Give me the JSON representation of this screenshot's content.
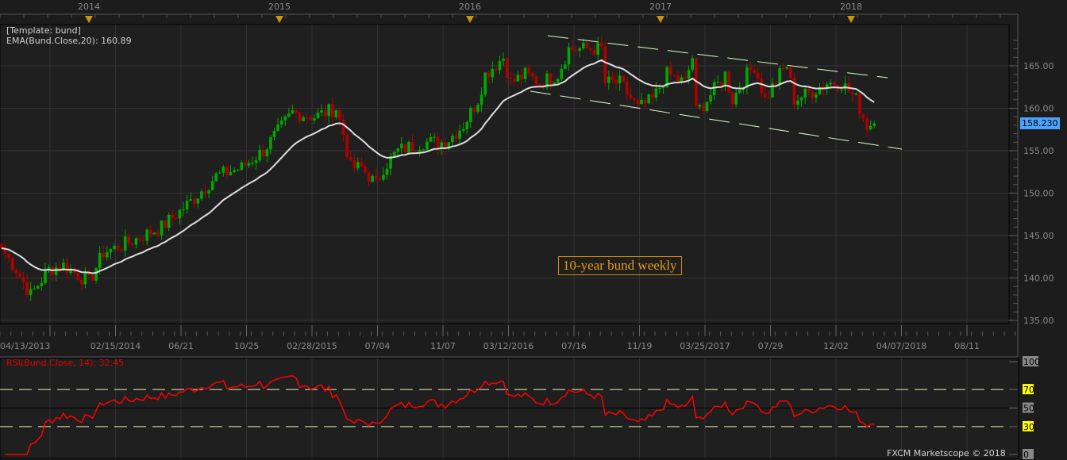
{
  "legend": {
    "template": "[Template: bund]",
    "ema": "EMA(Bund.Close,20): 160.89"
  },
  "rsi_label": "RSI(Bund.Close, 14): 32.45",
  "current_price": "158.230",
  "annotation": "10-year bund weekly",
  "footer": "FXCM Marketscope © 2018",
  "colors": {
    "bull": "#00a800",
    "bear": "#b00000",
    "ema": "#dddddd",
    "rsi": "#ff0000",
    "channel": "#d8ffc8",
    "badge": "#4aa3ff"
  },
  "chart_data": {
    "type": "candlestick",
    "title": "10-year bund weekly",
    "years": [
      "2014",
      "2015",
      "2016",
      "2017",
      "2018"
    ],
    "date_labels": [
      "04/13/2013",
      "02/15/2014",
      "06/21",
      "10/25",
      "02/28/2015",
      "07/04",
      "11/07",
      "03/12/2016",
      "07/16",
      "11/19",
      "03/25/2017",
      "07/29",
      "12/02",
      "04/07/2018",
      "08/11"
    ],
    "price_ticks": [
      "165.00",
      "160.00",
      "155.00",
      "150.00",
      "145.00",
      "140.00",
      "135.00"
    ],
    "price_tick_values": [
      165,
      160,
      155,
      150,
      145,
      140,
      135
    ],
    "ylim": [
      134,
      169
    ],
    "rsi_ticks": [
      "100",
      "70",
      "50",
      "30",
      "0"
    ],
    "rsi_tick_values": [
      100,
      70,
      50,
      30,
      0
    ],
    "weekly_close_keyframes": [
      [
        0,
        143.5
      ],
      [
        4,
        141
      ],
      [
        8,
        138
      ],
      [
        13,
        141
      ],
      [
        17,
        141.5
      ],
      [
        24,
        139.5
      ],
      [
        28,
        143
      ],
      [
        34,
        144
      ],
      [
        44,
        146
      ],
      [
        52,
        149
      ],
      [
        59,
        152
      ],
      [
        66,
        153
      ],
      [
        72,
        155
      ],
      [
        80,
        159.5
      ],
      [
        86,
        159
      ],
      [
        92,
        160
      ],
      [
        94,
        157
      ],
      [
        96,
        153
      ],
      [
        99,
        153
      ],
      [
        103,
        151
      ],
      [
        105,
        153
      ],
      [
        109,
        155
      ],
      [
        116,
        156
      ],
      [
        122,
        156
      ],
      [
        127,
        158
      ],
      [
        131,
        161
      ],
      [
        133,
        164
      ],
      [
        138,
        166
      ],
      [
        140,
        163
      ],
      [
        144,
        164
      ],
      [
        148,
        163
      ],
      [
        153,
        164
      ],
      [
        156,
        167
      ],
      [
        162,
        167
      ],
      [
        165,
        167
      ],
      [
        166,
        163
      ],
      [
        170,
        163
      ],
      [
        175,
        160
      ],
      [
        179,
        161
      ],
      [
        183,
        164
      ],
      [
        188,
        163
      ],
      [
        190,
        166
      ],
      [
        191,
        159.5
      ],
      [
        194,
        161
      ],
      [
        199,
        164
      ],
      [
        201,
        161
      ],
      [
        205,
        164
      ],
      [
        207,
        165
      ],
      [
        210,
        161
      ],
      [
        214,
        164
      ],
      [
        216,
        165
      ],
      [
        218,
        161
      ],
      [
        223,
        162
      ],
      [
        227,
        163
      ],
      [
        231,
        163
      ],
      [
        235,
        161
      ],
      [
        238,
        158
      ],
      [
        240,
        158.2
      ]
    ],
    "ema_period": 20,
    "rsi_period": 14,
    "rsi_last": 32.45,
    "ema_last": 160.89,
    "last_close": 158.23
  }
}
